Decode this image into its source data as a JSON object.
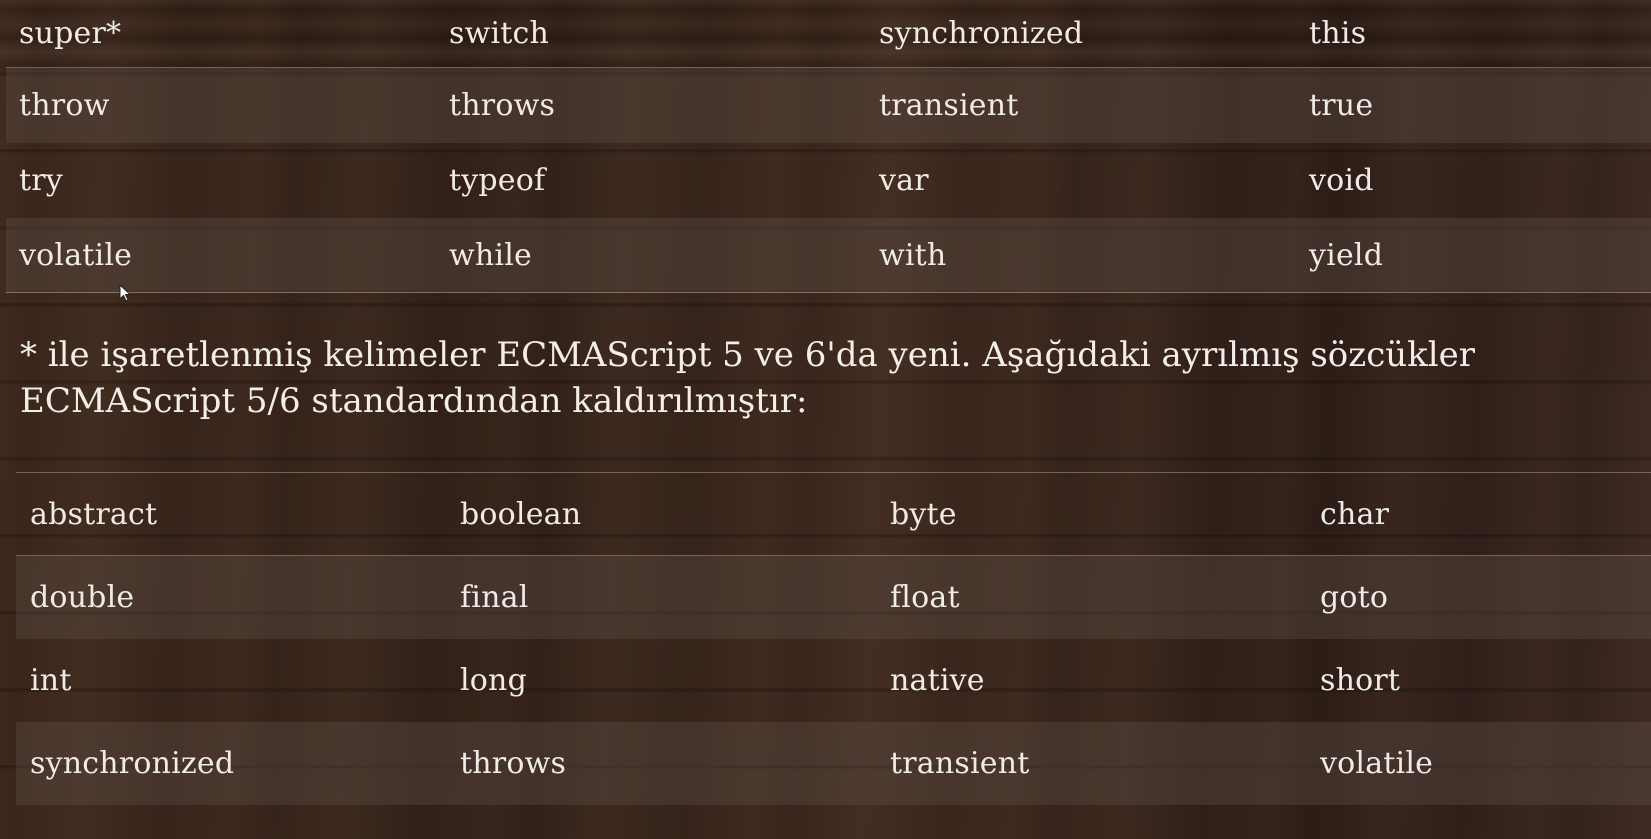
{
  "top_table": {
    "rows": [
      [
        "super*",
        "switch",
        "synchronized",
        "this"
      ],
      [
        "throw",
        "throws",
        "transient",
        "true"
      ],
      [
        "try",
        "typeof",
        "var",
        "void"
      ],
      [
        "volatile",
        "while",
        "with",
        "yield"
      ]
    ]
  },
  "note": {
    "line1": "* ile işaretlenmiş kelimeler ECMAScript 5 ve 6'da yeni. Aşağıdaki ayrılmış sözcükler",
    "line2": "ECMAScript 5/6 standardından kaldırılmıştır:"
  },
  "bottom_table": {
    "rows": [
      [
        "abstract",
        "boolean",
        "byte",
        "char"
      ],
      [
        "double",
        "final",
        "float",
        "goto"
      ],
      [
        "int",
        "long",
        "native",
        "short"
      ],
      [
        "synchronized",
        "throws",
        "transient",
        "volatile"
      ]
    ]
  },
  "colors": {
    "text": "#f0ebe6",
    "row_shade": "#5f5048",
    "wood_background": "#2f1d14"
  }
}
